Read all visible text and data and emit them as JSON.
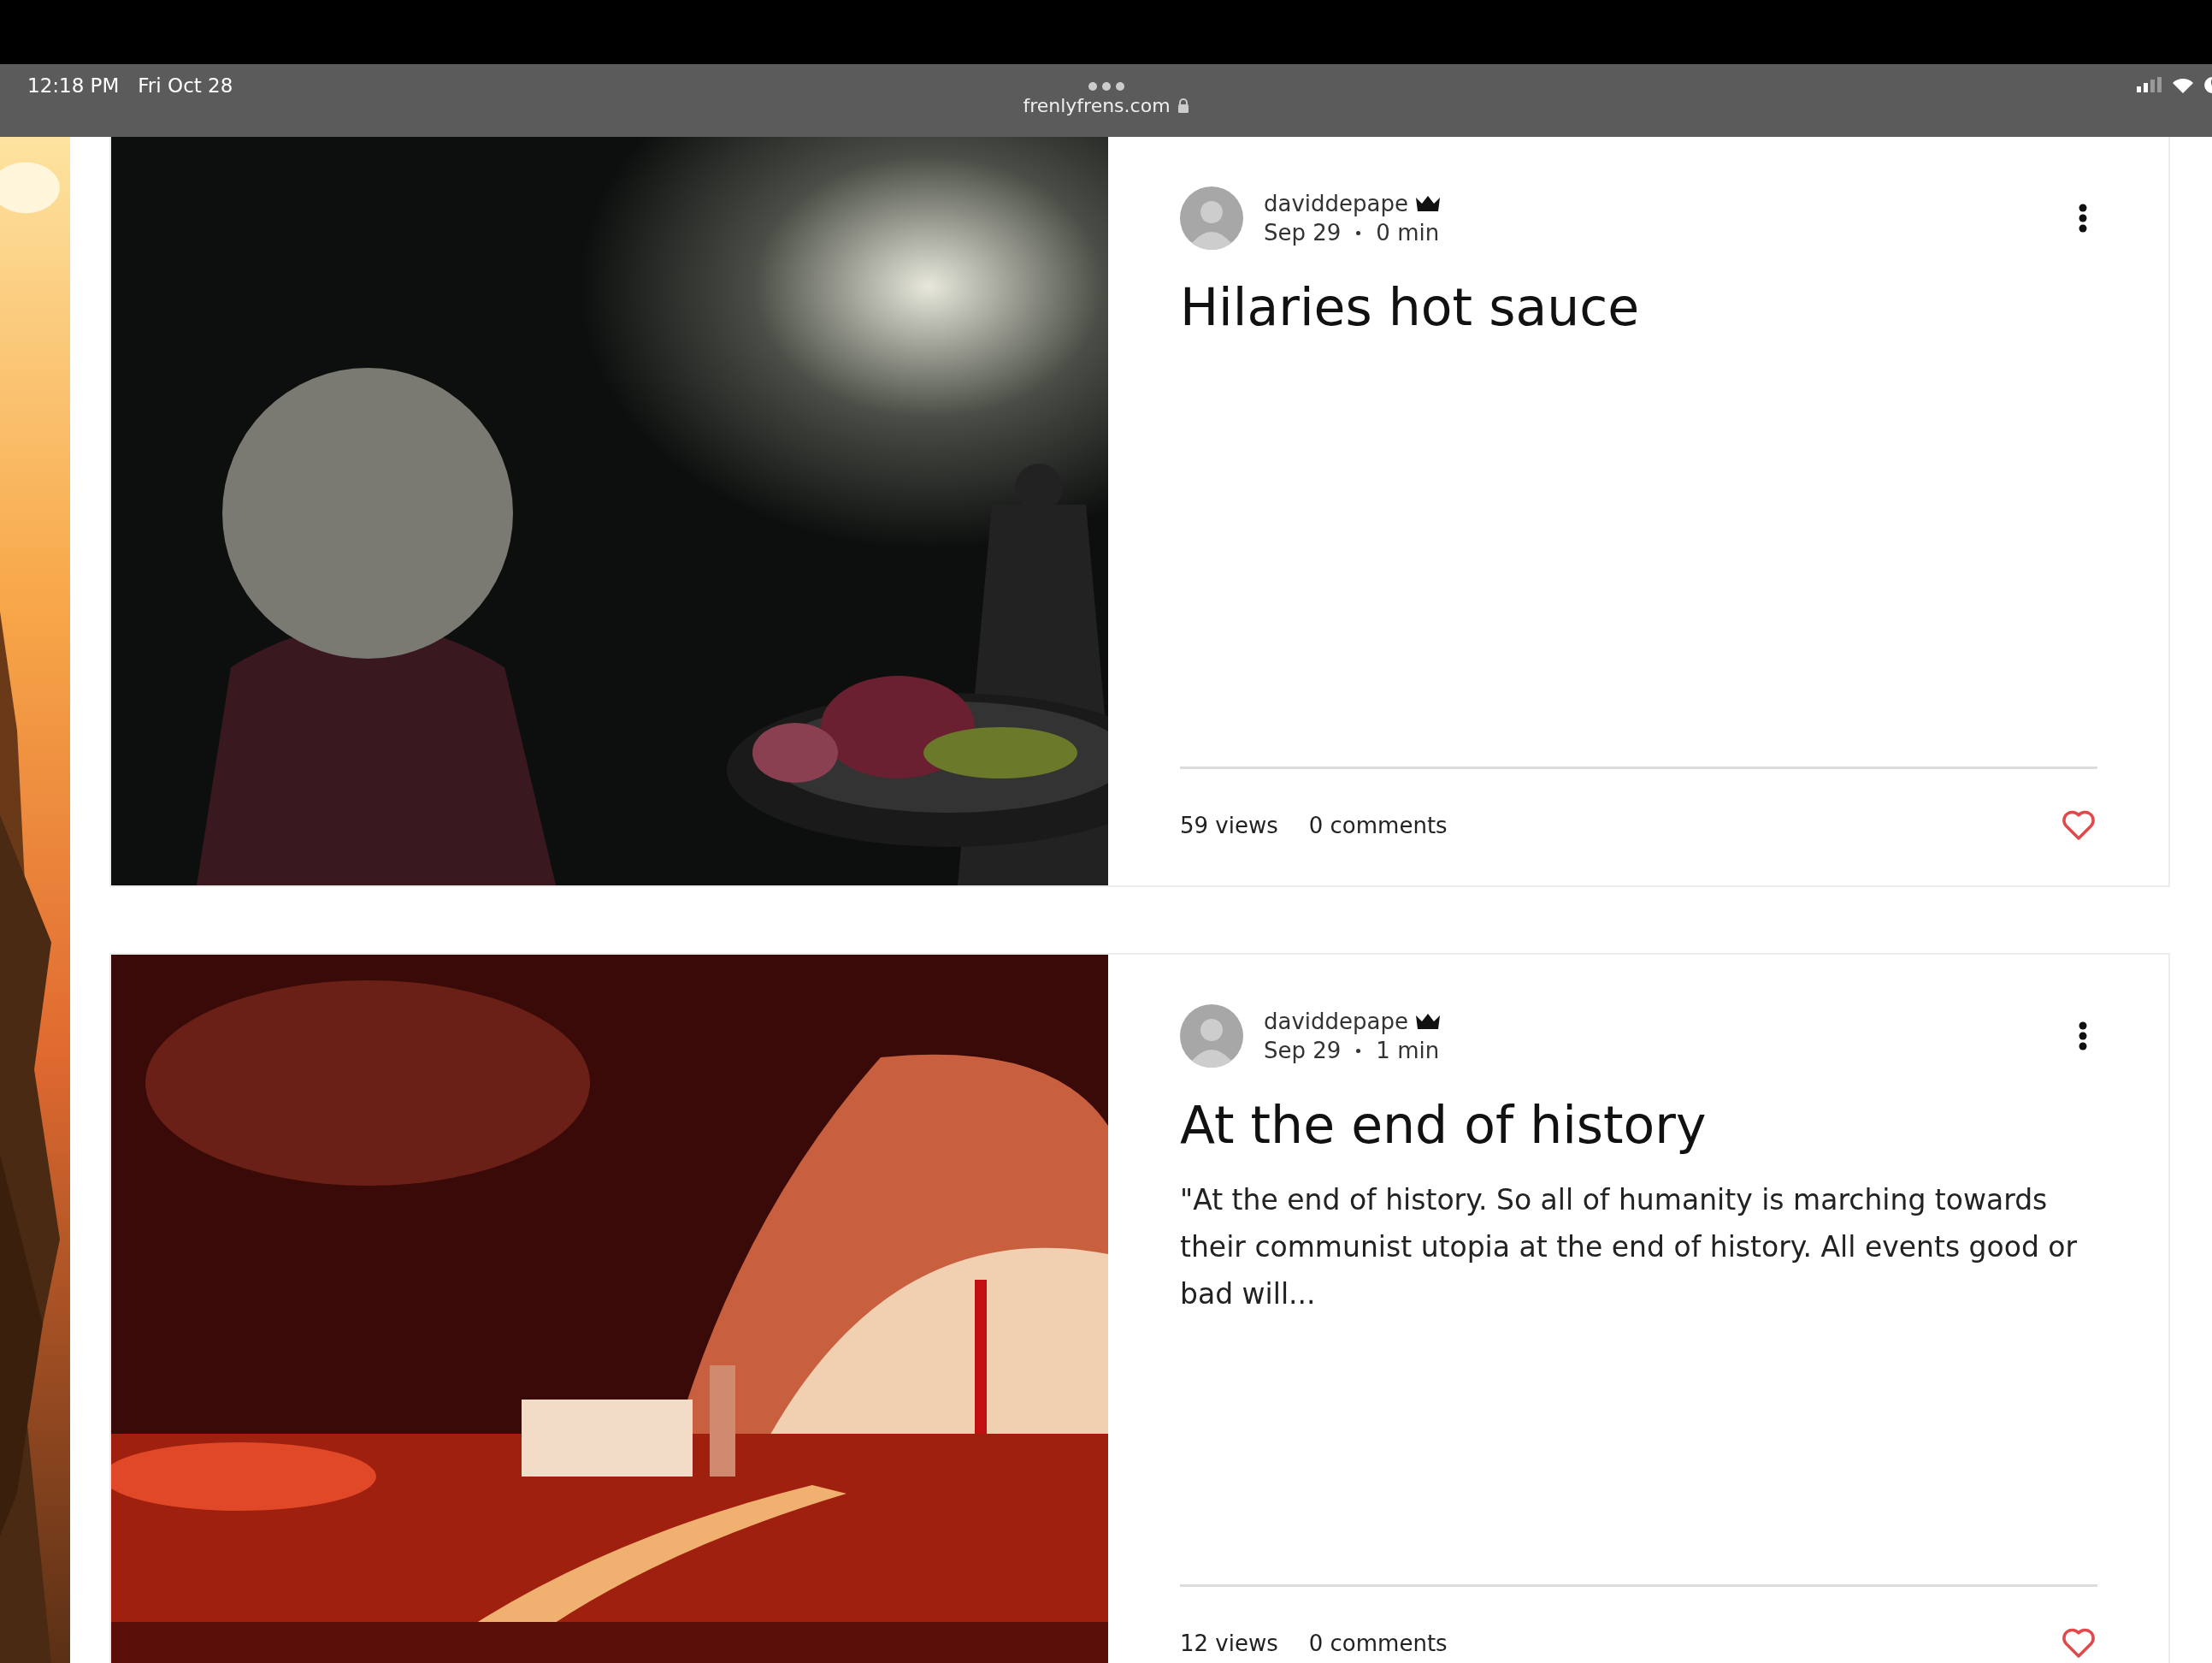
{
  "status_bar": {
    "time": "12:18 PM",
    "date": "Fri Oct 28",
    "url": "frenlyfrens.com"
  },
  "posts": [
    {
      "author": "daviddepape",
      "date": "Sep 29",
      "read_time": "0 min",
      "title": "Hilaries hot sauce",
      "views": "59 views",
      "comments": "0 comments"
    },
    {
      "author": "daviddepape",
      "date": "Sep 29",
      "read_time": "1 min",
      "title": "At the end of history",
      "excerpt": "\"At the end of history. So all of humanity is marching towards their communist utopia at the end of history. All events good or bad will...",
      "views": "12 views",
      "comments": "0 comments"
    }
  ]
}
